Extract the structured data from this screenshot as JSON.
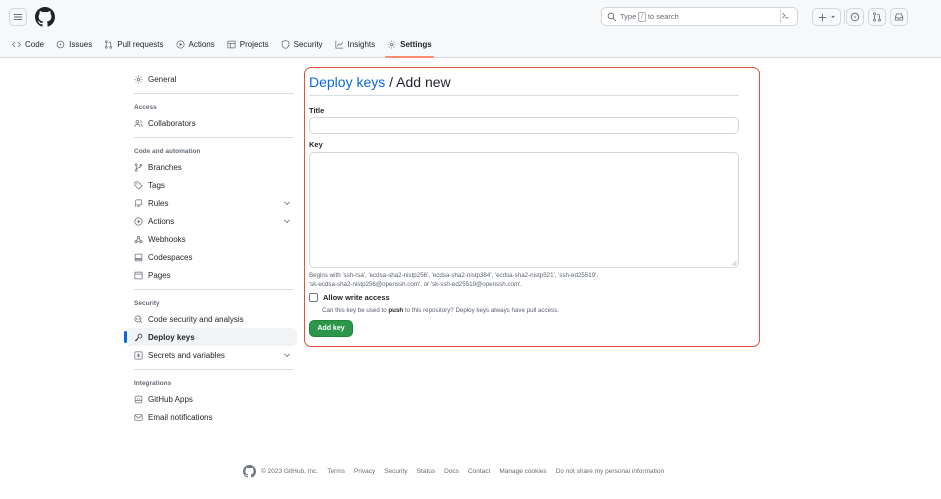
{
  "header": {
    "search_text_before": "Type",
    "search_key": "/",
    "search_text_after": "to search"
  },
  "nav": {
    "tabs": [
      {
        "label": "Code",
        "icon": "code-icon"
      },
      {
        "label": "Issues",
        "icon": "issue-icon"
      },
      {
        "label": "Pull requests",
        "icon": "pull-request-icon"
      },
      {
        "label": "Actions",
        "icon": "play-icon"
      },
      {
        "label": "Projects",
        "icon": "table-icon"
      },
      {
        "label": "Security",
        "icon": "shield-icon"
      },
      {
        "label": "Insights",
        "icon": "graph-icon"
      },
      {
        "label": "Settings",
        "icon": "gear-icon",
        "active": true
      }
    ]
  },
  "sidebar": {
    "general": "General",
    "access_heading": "Access",
    "collaborators": "Collaborators",
    "code_heading": "Code and automation",
    "branches": "Branches",
    "tags": "Tags",
    "rules": "Rules",
    "actions": "Actions",
    "webhooks": "Webhooks",
    "codespaces": "Codespaces",
    "pages": "Pages",
    "security_heading": "Security",
    "code_security": "Code security and analysis",
    "deploy_keys": "Deploy keys",
    "secrets": "Secrets and variables",
    "integrations_heading": "Integrations",
    "github_apps": "GitHub Apps",
    "email_notifications": "Email notifications"
  },
  "form": {
    "breadcrumb_link": "Deploy keys",
    "breadcrumb_rest": " / Add new",
    "title_label": "Title",
    "title_value": "",
    "key_label": "Key",
    "key_value": "",
    "hint_line1": "Begins with 'ssh-rsa', 'ecdsa-sha2-nistp256', 'ecdsa-sha2-nistp384', 'ecdsa-sha2-nistp521', 'ssh-ed25519',",
    "hint_line2": "'sk-ecdsa-sha2-nistp256@openssh.com', or 'sk-ssh-ed25519@openssh.com'.",
    "write_access_label": "Allow write access",
    "write_note_before": "Can this key be used to ",
    "write_note_bold": "push",
    "write_note_after": " to this repository? Deploy keys always have pull access.",
    "submit_label": "Add key"
  },
  "footer": {
    "copyright": "© 2023 GitHub, Inc.",
    "links": [
      "Terms",
      "Privacy",
      "Security",
      "Status",
      "Docs",
      "Contact",
      "Manage cookies",
      "Do not share my personal information"
    ]
  },
  "colors": {
    "accent_blue": "#0969da",
    "primary_green": "#2c974b",
    "highlight_red": "#e0533a",
    "tab_underline": "#fd8c73"
  }
}
